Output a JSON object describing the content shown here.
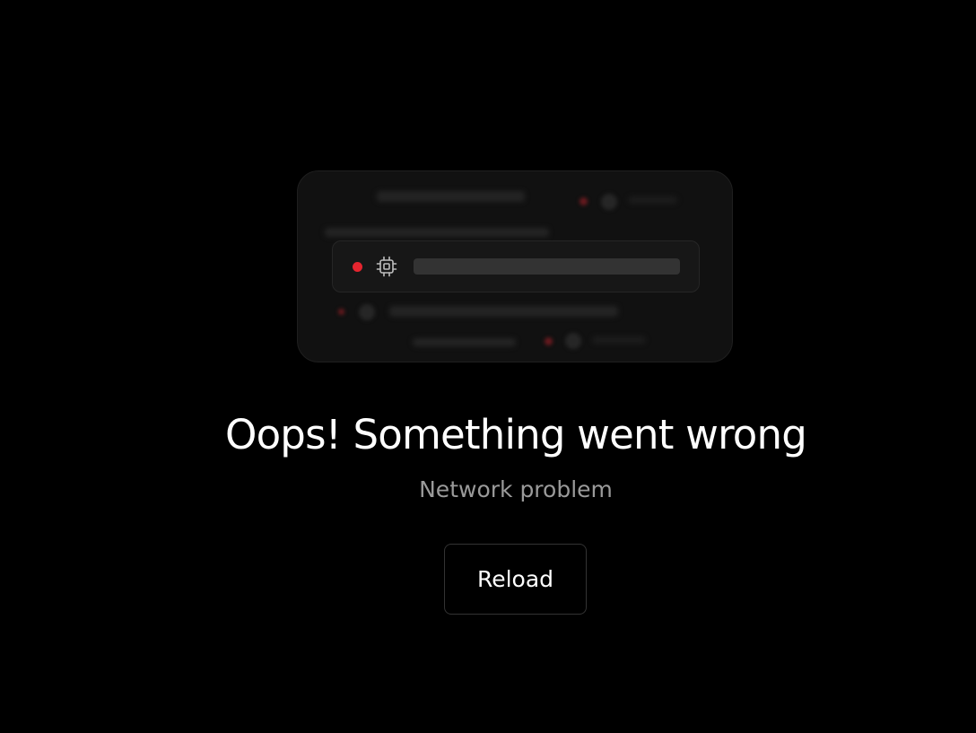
{
  "error": {
    "title": "Oops! Something went wrong",
    "subtitle": "Network problem"
  },
  "actions": {
    "reload_label": "Reload"
  },
  "illustration": {
    "status_color": "#e5252f",
    "icon": "cpu-chip-icon"
  }
}
